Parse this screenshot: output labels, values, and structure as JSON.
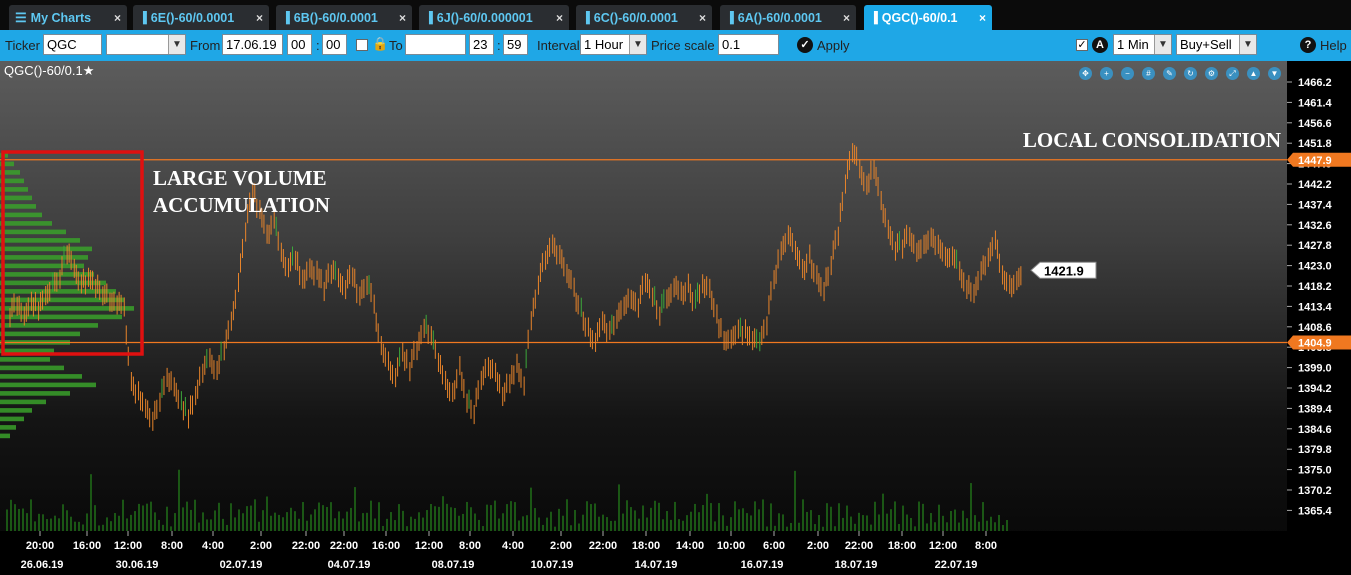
{
  "tabs": [
    {
      "label": "My Charts",
      "icon": "menu-icon",
      "active": false
    },
    {
      "label": "6E()-60/0.0001",
      "icon": "chart-icon",
      "active": false
    },
    {
      "label": "6B()-60/0.0001",
      "icon": "chart-icon",
      "active": false
    },
    {
      "label": "6J()-60/0.000001",
      "icon": "chart-icon",
      "active": false
    },
    {
      "label": "6C()-60/0.0001",
      "icon": "chart-icon",
      "active": false
    },
    {
      "label": "6A()-60/0.0001",
      "icon": "chart-icon",
      "active": false
    },
    {
      "label": "QGC()-60/0.1",
      "icon": "chart-icon",
      "active": true
    }
  ],
  "toolbar": {
    "ticker_label": "Ticker",
    "ticker_value": "QGC",
    "from_label": "From",
    "from_date": "17.06.19",
    "from_hour": "00",
    "from_min": "00",
    "to_label": "To",
    "to_date": "",
    "to_hour": "23",
    "to_min": "59",
    "interval_label": "Interval",
    "interval_value": "1 Hour",
    "price_scale_label": "Price scale",
    "price_scale_value": "0.1",
    "apply_label": "Apply",
    "timeframe_value": "1 Min",
    "side_value": "Buy+Sell",
    "help_label": "Help",
    "a_icon_letter": "A"
  },
  "chart": {
    "title": "QGC()-60/0.1",
    "annotations": {
      "large_volume_line1": "LARGE VOLUME",
      "large_volume_line2": "ACCUMULATION",
      "local_consolidation": "LOCAL CONSOLIDATION"
    },
    "colors": {
      "candle": "#e8842a",
      "accent": "#f07820",
      "profile": "#3aa12a",
      "box": "#e01010",
      "tab_active": "#1aa8e8"
    }
  },
  "chart_data": {
    "type": "line",
    "y_ticks": [
      "1466.2",
      "1461.4",
      "1456.6",
      "1451.8",
      "1447.0",
      "1442.2",
      "1437.4",
      "1432.6",
      "1427.8",
      "1423.0",
      "1418.2",
      "1413.4",
      "1408.6",
      "1403.8",
      "1399.0",
      "1394.2",
      "1389.4",
      "1384.6",
      "1379.8",
      "1375.0",
      "1370.2",
      "1365.4"
    ],
    "x_ticks_time": [
      "20:00",
      "16:00",
      "12:00",
      "8:00",
      "4:00",
      "2:00",
      "22:00",
      "22:00",
      "16:00",
      "12:00",
      "8:00",
      "4:00",
      "2:00",
      "22:00",
      "18:00",
      "14:00",
      "10:00",
      "6:00",
      "2:00",
      "22:00",
      "18:00",
      "12:00",
      "8:00"
    ],
    "x_ticks_date": [
      "26.06.19",
      "30.06.19",
      "02.07.19",
      "04.07.19",
      "08.07.19",
      "10.07.19",
      "14.07.19",
      "16.07.19",
      "18.07.19",
      "22.07.19"
    ],
    "horizontal_levels": [
      {
        "value": 1447.9,
        "label": "1447.9"
      },
      {
        "value": 1404.9,
        "label": "1404.9"
      }
    ],
    "current_price": {
      "value": 1421.9,
      "label": "1421.9"
    },
    "ylim": [
      1362,
      1470
    ],
    "series": [
      {
        "values": [
          1412,
          1414,
          1411,
          1415,
          1413,
          1416,
          1418,
          1421,
          1426,
          1423,
          1419,
          1420,
          1418,
          1417,
          1415,
          1414,
          1413,
          1395,
          1393,
          1390,
          1387,
          1391,
          1397,
          1395,
          1390,
          1388,
          1392,
          1398,
          1401,
          1399,
          1403,
          1410,
          1418,
          1432,
          1441,
          1436,
          1430,
          1433,
          1427,
          1422,
          1425,
          1420,
          1423,
          1421,
          1418,
          1422,
          1420,
          1418,
          1421,
          1416,
          1419,
          1414,
          1404,
          1400,
          1397,
          1402,
          1399,
          1404,
          1409,
          1406,
          1401,
          1396,
          1393,
          1399,
          1391,
          1389,
          1395,
          1400,
          1397,
          1393,
          1396,
          1399,
          1395,
          1410,
          1418,
          1425,
          1428,
          1425,
          1422,
          1417,
          1412,
          1408,
          1405,
          1411,
          1407,
          1410,
          1413,
          1416,
          1414,
          1419,
          1416,
          1412,
          1415,
          1419,
          1416,
          1418,
          1414,
          1419,
          1417,
          1411,
          1406,
          1405,
          1407,
          1408,
          1406,
          1404,
          1410,
          1420,
          1426,
          1430,
          1427,
          1422,
          1425,
          1420,
          1417,
          1424,
          1431,
          1443,
          1450,
          1447,
          1442,
          1446,
          1438,
          1432,
          1427,
          1428,
          1430,
          1426,
          1427,
          1430,
          1428,
          1425,
          1426,
          1422,
          1418,
          1417,
          1422,
          1425,
          1430,
          1422,
          1418,
          1420,
          1421.9
        ]
      }
    ]
  }
}
